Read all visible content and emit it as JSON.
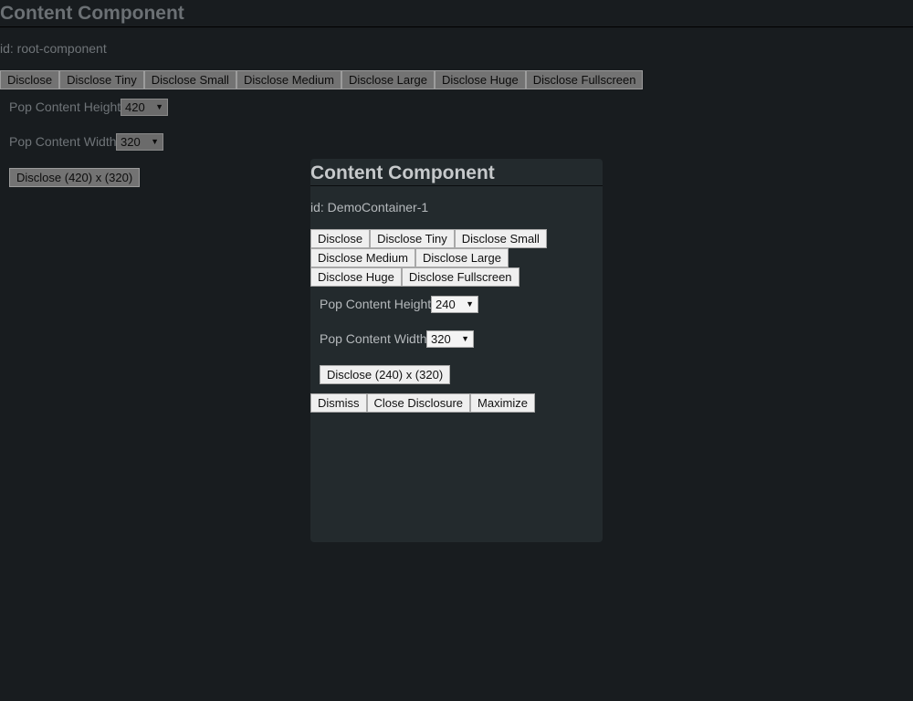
{
  "root": {
    "title": "Content Component",
    "id_text": "id: root-component",
    "disclose_buttons": [
      "Disclose",
      "Disclose Tiny",
      "Disclose Small",
      "Disclose Medium",
      "Disclose Large",
      "Disclose Huge",
      "Disclose Fullscreen"
    ],
    "height_label": "Pop Content Height",
    "height_value": "420",
    "width_label": "Pop Content Width",
    "width_value": "320",
    "custom_disclose_label": "Disclose (420) x (320)"
  },
  "popup": {
    "title": "Content Component",
    "id_text": "id: DemoContainer-1",
    "disclose_buttons": [
      "Disclose",
      "Disclose Tiny",
      "Disclose Small",
      "Disclose Medium",
      "Disclose Large",
      "Disclose Huge",
      "Disclose Fullscreen"
    ],
    "height_label": "Pop Content Height",
    "height_value": "240",
    "width_label": "Pop Content Width",
    "width_value": "320",
    "custom_disclose_label": "Disclose (240) x (320)",
    "dismiss_label": "Dismiss",
    "close_label": "Close Disclosure",
    "maximize_label": "Maximize"
  },
  "icons": {
    "dropdown_caret": "▼"
  },
  "colors": {
    "page_background": "#181c1f",
    "popup_background": "#232a2d"
  }
}
